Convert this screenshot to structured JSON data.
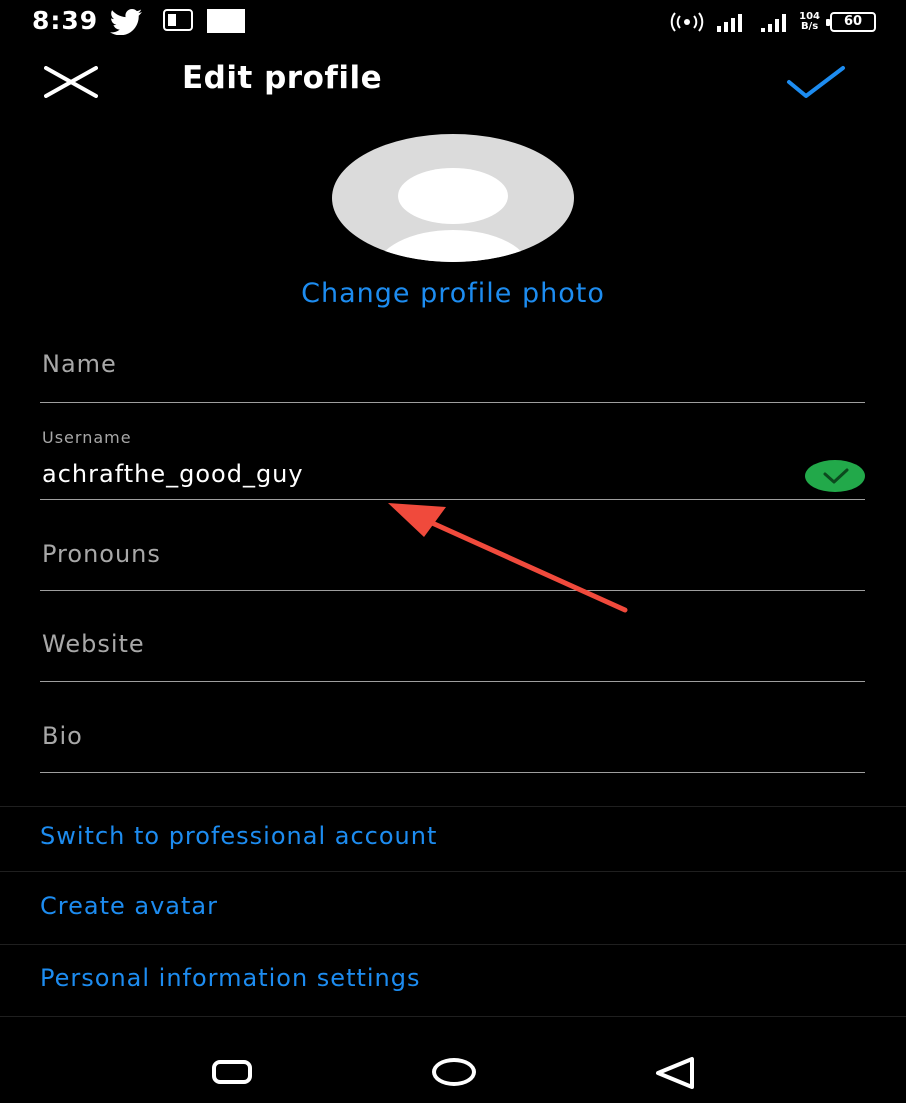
{
  "status_bar": {
    "time": "8:39",
    "network_speed_top": "104",
    "network_speed_bottom": "B/s",
    "battery": "60"
  },
  "header": {
    "title": "Edit profile"
  },
  "profile": {
    "change_photo_label": "Change profile photo"
  },
  "fields": {
    "name_placeholder": "Name",
    "username_label": "Username",
    "username_value": "achrafthe_good_guy",
    "pronouns_placeholder": "Pronouns",
    "website_placeholder": "Website",
    "bio_placeholder": "Bio"
  },
  "links": {
    "professional": "Switch to professional account",
    "avatar": "Create avatar",
    "personal_info": "Personal information settings"
  },
  "colors": {
    "accent": "#1d8cf0",
    "valid": "#22a94a",
    "annotation": "#f04a3c"
  }
}
